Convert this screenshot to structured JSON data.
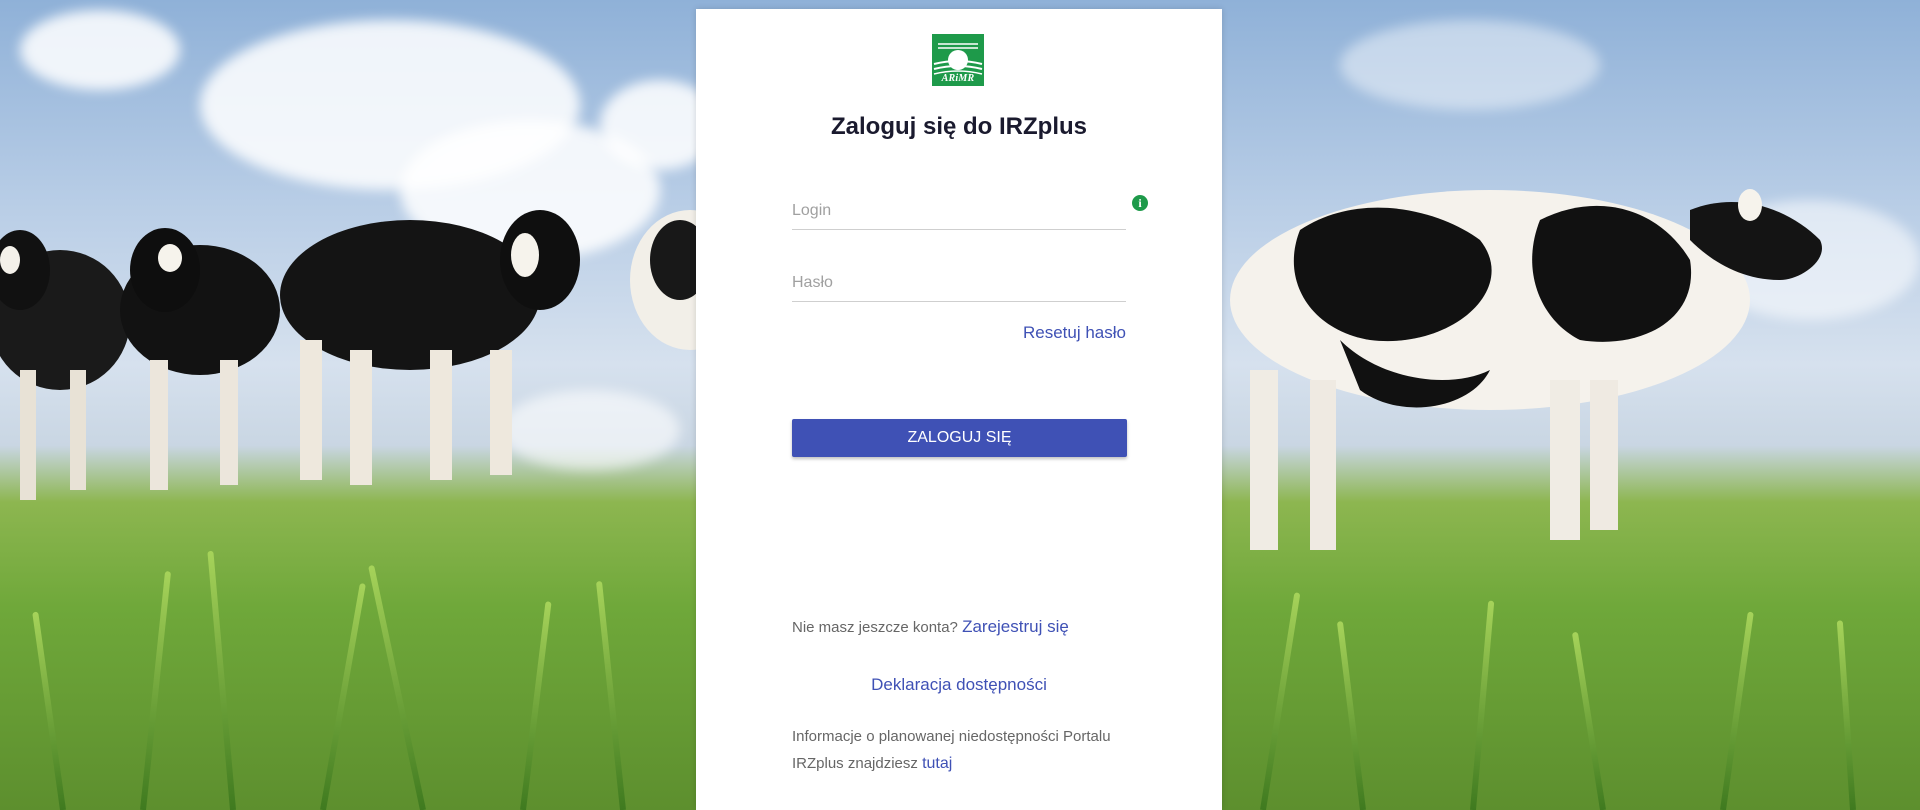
{
  "login_page": {
    "title": "Zaloguj się do IRZplus",
    "logo_text": "ARiMR",
    "login_field": {
      "placeholder": "Login",
      "value": ""
    },
    "password_field": {
      "placeholder": "Hasło",
      "value": ""
    },
    "reset_password_link": "Resetuj hasło",
    "login_button_label": "ZALOGUJ SIĘ",
    "register_prompt": "Nie masz jeszcze konta?",
    "register_link": "Zarejestruj się",
    "accessibility_declaration_link": "Deklaracja dostępności",
    "maintenance_info_text": "Informacje o planowanej niedostępności Portalu IRZplus znajdziesz",
    "maintenance_info_link": "tutaj",
    "info_icon": "info-icon"
  },
  "colors": {
    "primary": "#3f51b5",
    "logo_green": "#1e9a4a",
    "title_text": "#1a1a2e",
    "muted_text": "#666666"
  }
}
